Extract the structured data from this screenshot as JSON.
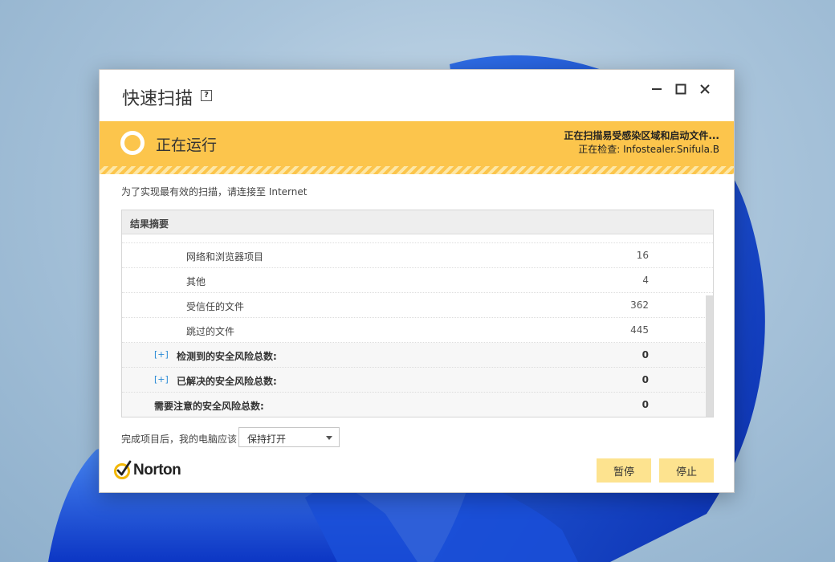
{
  "window": {
    "title": "快速扫描",
    "help_glyph": "?"
  },
  "status": {
    "state": "正在运行",
    "scan_line1": "正在扫描易受感染区域和启动文件...",
    "scan_line2": "正在检查: Infostealer.Snifula.B"
  },
  "notice": "为了实现最有效的扫描，请连接至 Internet",
  "results": {
    "header": "结果摘要",
    "rows": [
      {
        "label": "网络和浏览器项目",
        "value": "16"
      },
      {
        "label": "其他",
        "value": "4"
      },
      {
        "label": "受信任的文件",
        "value": "362"
      },
      {
        "label": "跳过的文件",
        "value": "445"
      },
      {
        "expander": "[+]",
        "label": "检测到的安全风险总数:",
        "value": "0"
      },
      {
        "expander": "[+]",
        "label": "已解决的安全风险总数:",
        "value": "0"
      },
      {
        "label": "需要注意的安全风险总数:",
        "value": "0"
      }
    ]
  },
  "after_scan": {
    "label": "完成项目后，我的电脑应该",
    "selected": "保持打开"
  },
  "brand": {
    "name": "Norton",
    "accent": "#fcc54c"
  },
  "buttons": {
    "pause": "暂停",
    "stop": "停止"
  }
}
